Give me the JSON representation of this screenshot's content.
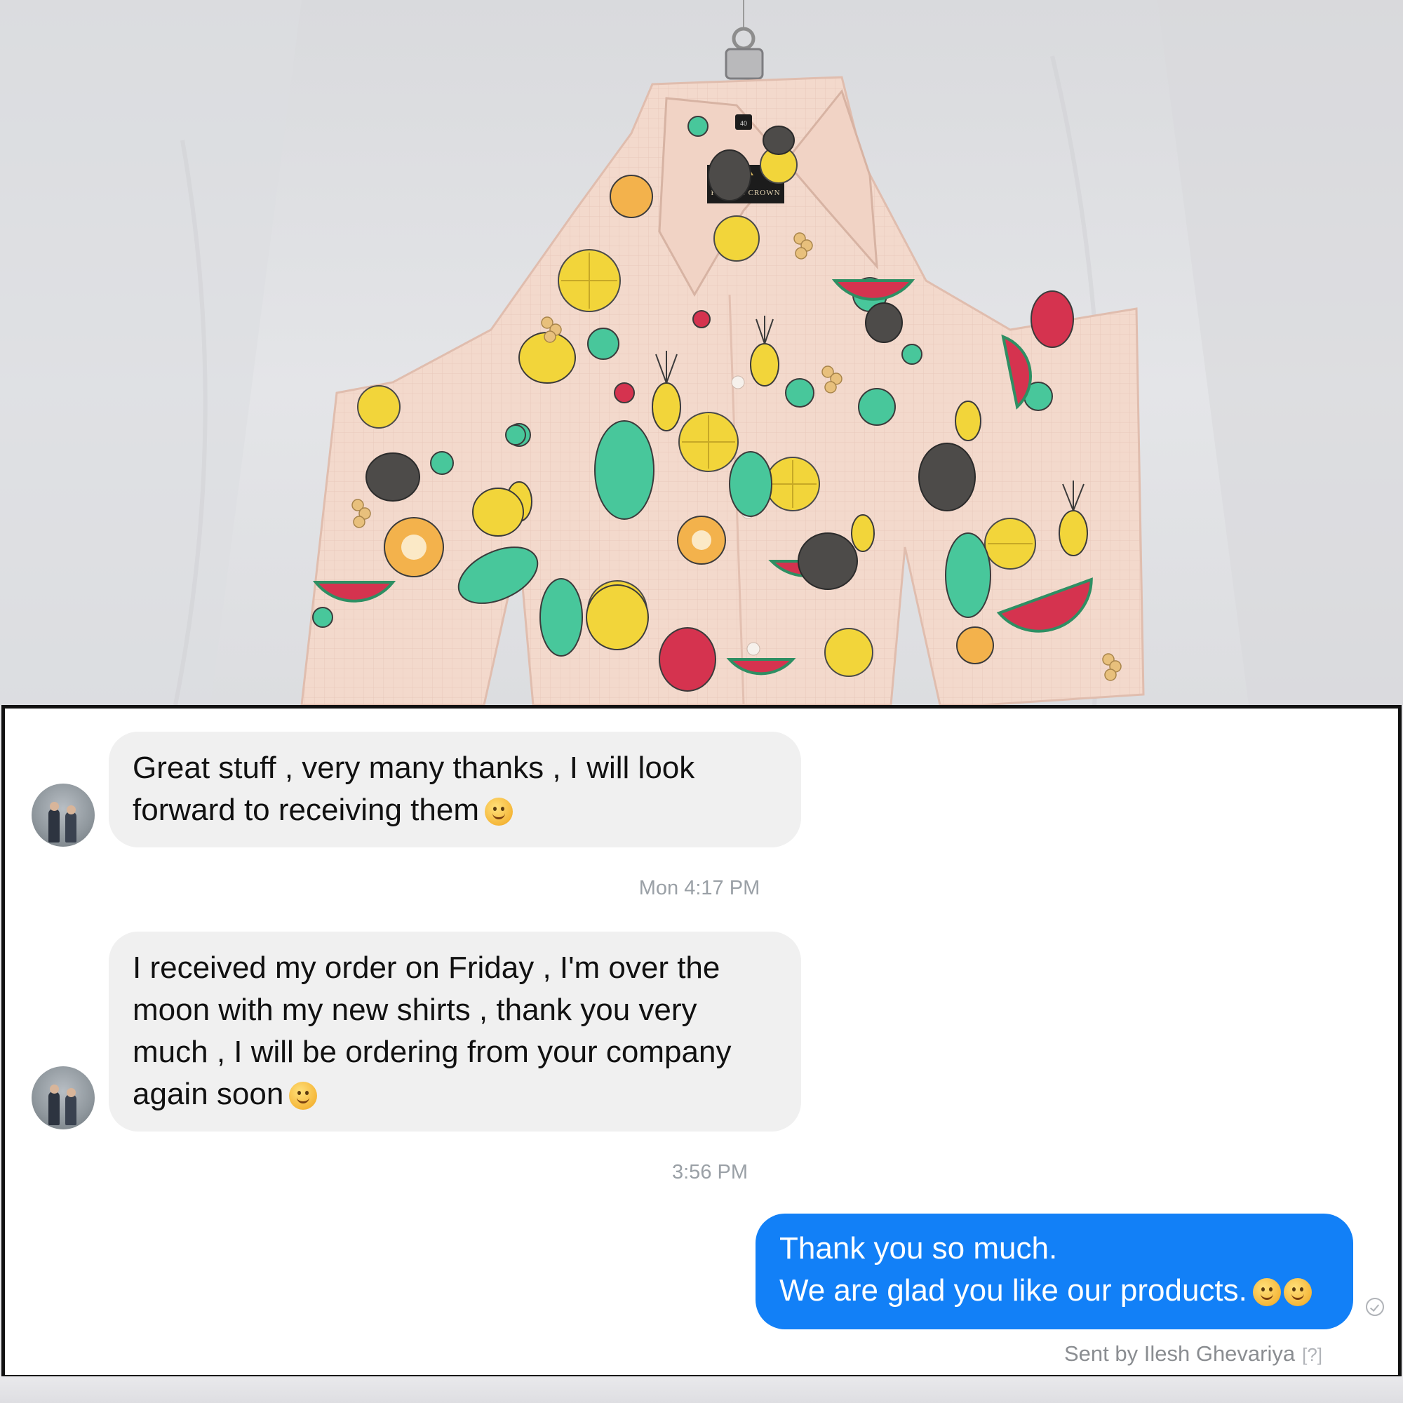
{
  "photo": {
    "garment_label": "FRENCH CROWN",
    "size_tag": "40",
    "colors": {
      "fabric": "#f3d9cc",
      "lemon_yellow": "#f2d53a",
      "mint_green": "#48c79b",
      "watermelon_red": "#d5334f",
      "dark_fig": "#4d4b49",
      "orange": "#f3b24c"
    }
  },
  "chat": {
    "messages": [
      {
        "direction": "incoming",
        "lines": [
          "Great stuff , very many thanks , I will look",
          "forward to receiving them"
        ],
        "emoji": "grinning-face"
      },
      {
        "direction": "incoming",
        "lines": [
          "I received my order on Friday , I'm over the",
          "moon with my new shirts , thank you very",
          "much , I will be ordering from your company",
          "again soon"
        ],
        "emoji": "smiling-face"
      },
      {
        "direction": "outgoing",
        "lines": [
          "Thank you so much.",
          "We are glad you like our products."
        ],
        "emoji": "smiling-face"
      }
    ],
    "timestamps": [
      "Mon 4:17 PM",
      "3:56 PM"
    ],
    "sent_by": "Sent by Ilesh Ghevariya",
    "sent_by_help": "[?]",
    "colors": {
      "incoming_bubble": "#f0f0f0",
      "outgoing_bubble": "#1280f7",
      "timestamp": "#9aa0a6"
    }
  }
}
